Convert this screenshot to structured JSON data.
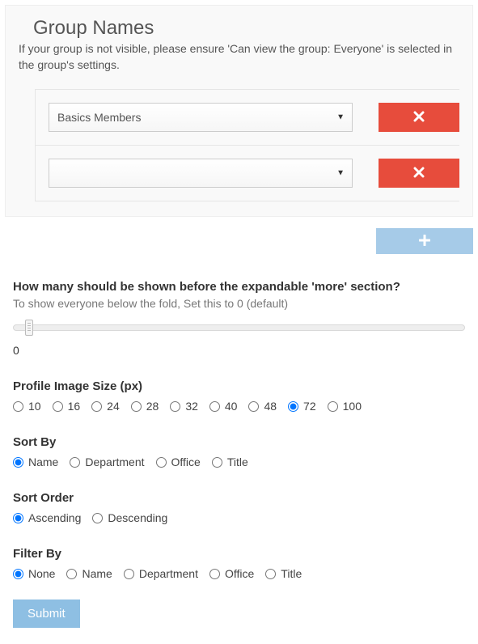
{
  "group_names": {
    "title": "Group Names",
    "description": "If your group is not visible, please ensure 'Can view the group: Everyone' is selected in the group's settings.",
    "rows": [
      {
        "selected": "Basics Members"
      },
      {
        "selected": ""
      }
    ]
  },
  "show_count": {
    "label": "How many should be shown before the expandable 'more' section?",
    "help": "To show everyone below the fold, Set this to 0 (default)",
    "value": "0"
  },
  "image_size": {
    "label": "Profile Image Size (px)",
    "options": [
      "10",
      "16",
      "24",
      "28",
      "32",
      "40",
      "48",
      "72",
      "100"
    ],
    "selected": "72"
  },
  "sort_by": {
    "label": "Sort By",
    "options": [
      "Name",
      "Department",
      "Office",
      "Title"
    ],
    "selected": "Name"
  },
  "sort_order": {
    "label": "Sort Order",
    "options": [
      "Ascending",
      "Descending"
    ],
    "selected": "Ascending"
  },
  "filter_by": {
    "label": "Filter By",
    "options": [
      "None",
      "Name",
      "Department",
      "Office",
      "Title"
    ],
    "selected": "None"
  },
  "submit_label": "Submit"
}
